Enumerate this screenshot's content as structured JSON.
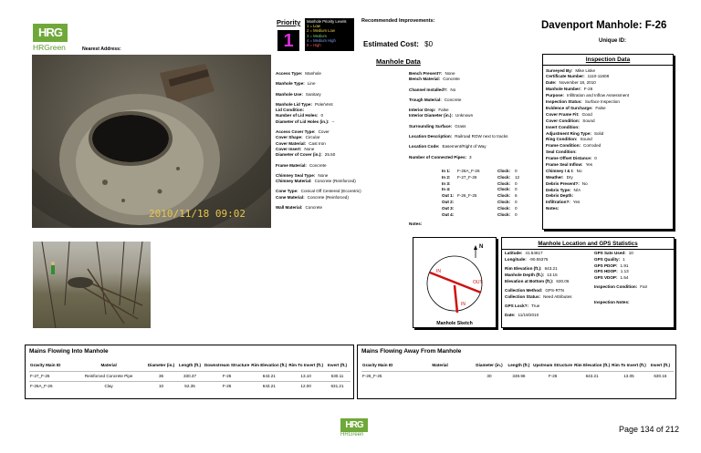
{
  "brand": {
    "logo_text": "HRGreen",
    "logo_mark": "HRG"
  },
  "header": {
    "nearest_address_label": "Nearest Address:",
    "priority_label": "Priority",
    "priority_value": "1",
    "priority_legend_title": "Manhole Priority Levels",
    "priority_legend": [
      "1 = Low",
      "2 = Medium Low",
      "3 = Medium",
      "4 = Medium High",
      "5 = High"
    ],
    "recommended_label": "Recommended Improvements:",
    "estimated_cost_label": "Estimated Cost:",
    "estimated_cost_value": "$0",
    "title": "Davenport Manhole:  F-26",
    "unique_id_label": "Unique ID:"
  },
  "photo1": {
    "timestamp": "2010/11/18  09:02"
  },
  "manhole_data": {
    "title": "Manhole Data",
    "left_col": [
      {
        "label": "Access Type:",
        "value": "Manhole"
      },
      {
        "label": "Manhole Type:",
        "value": "Line"
      },
      {
        "label": "Manhole Use:",
        "value": "Sanitary"
      },
      {
        "label": "Manhole Lid Type:",
        "value": "Pole/Vent"
      },
      {
        "label": "Lid Condition:",
        "value": ""
      },
      {
        "label": "Number of Lid Holes:",
        "value": "0"
      },
      {
        "label": "Diameter of Lid Holes (in.):",
        "value": "--"
      },
      {
        "label": "Access Cover Type:",
        "value": "Cover"
      },
      {
        "label": "Cover Shape:",
        "value": "Circular"
      },
      {
        "label": "Cover Material:",
        "value": "Cast Iron"
      },
      {
        "label": "Cover Insert:",
        "value": "None"
      },
      {
        "label": "Diameter of Cover (in.):",
        "value": "25.50"
      },
      {
        "label": "Frame Material:",
        "value": "Concrete"
      },
      {
        "label": "Chimney Seal Type:",
        "value": "None"
      },
      {
        "label": "Chimney Material:",
        "value": "Concrete (Reinforced)"
      },
      {
        "label": "Cone Type:",
        "value": "Conical Off Centered (Eccentric)"
      },
      {
        "label": "Cone Material:",
        "value": "Concrete (Reinforced)"
      },
      {
        "label": "Wall Material:",
        "value": "Concrete"
      }
    ],
    "right_col": [
      {
        "label": "Bench Present?:",
        "value": "None"
      },
      {
        "label": "Bench Material:",
        "value": "Concrete"
      },
      {
        "label": "Channel Installed?:",
        "value": "No"
      },
      {
        "label": "Trough Material:",
        "value": "Concrete"
      },
      {
        "label": "Interior Drop:",
        "value": "False"
      },
      {
        "label": "Interior Diameter (in.):",
        "value": "Unknown"
      },
      {
        "label": "Surrounding Surface:",
        "value": "Grass"
      },
      {
        "label": "Location Description:",
        "value": "Railroad ROW next to tracks"
      },
      {
        "label": "Location Code:",
        "value": "Easement/Right of Way"
      },
      {
        "label": "Number of Connected Pipes:",
        "value": "3"
      }
    ],
    "pipes": [
      {
        "label": "In 1:",
        "value": "F-26A_F-26",
        "clock_label": "Clock:",
        "clock": "0"
      },
      {
        "label": "In 2:",
        "value": "F-27_F-26",
        "clock_label": "Clock:",
        "clock": "12"
      },
      {
        "label": "In 3:",
        "value": "",
        "clock_label": "Clock:",
        "clock": "0"
      },
      {
        "label": "In 4:",
        "value": "",
        "clock_label": "Clock:",
        "clock": "0"
      },
      {
        "label": "Out 1:",
        "value": "F-26_F-25",
        "clock_label": "Clock:",
        "clock": "6"
      },
      {
        "label": "Out 2:",
        "value": "",
        "clock_label": "Clock:",
        "clock": "0"
      },
      {
        "label": "Out 3:",
        "value": "",
        "clock_label": "Clock:",
        "clock": "0"
      },
      {
        "label": "Out 4:",
        "value": "",
        "clock_label": "Clock:",
        "clock": "0"
      }
    ],
    "notes_label": "Notes:"
  },
  "inspection": {
    "title": "Inspection Data",
    "rows": [
      {
        "label": "Surveyed By:",
        "value": "Mike Liske"
      },
      {
        "label": "Certificate Number:",
        "value": "1110-11608"
      },
      {
        "label": "Date:",
        "value": "November 18, 2010"
      },
      {
        "label": "Manhole Number:",
        "value": "F-26"
      },
      {
        "label": "Purpose:",
        "value": "Infiltration and Inflow Assessment"
      },
      {
        "label": "Inspection Status:",
        "value": "Surface Inspection"
      },
      {
        "label": "Evidence of Surcharge:",
        "value": "False"
      },
      {
        "label": "Cover Frame Fit:",
        "value": "Good"
      },
      {
        "label": "Cover Condition:",
        "value": "Sound"
      },
      {
        "label": "Insert Condition:",
        "value": ""
      },
      {
        "label": "Adjustment Ring Type:",
        "value": "Solid"
      },
      {
        "label": "Ring Condition:",
        "value": "Sound"
      },
      {
        "label": "Frame Condition:",
        "value": "Corroded"
      },
      {
        "label": "Seal Condition:",
        "value": ""
      },
      {
        "label": "Frame Offset Distance:",
        "value": "0"
      },
      {
        "label": "Frame Seal Inflow:",
        "value": "Yes"
      },
      {
        "label": "Chimney I & I:",
        "value": "No"
      },
      {
        "label": "Weather:",
        "value": "Dry"
      },
      {
        "label": "Debris Present?:",
        "value": "No"
      },
      {
        "label": "Debris Type:",
        "value": "N/A"
      },
      {
        "label": "Debris Depth:",
        "value": ""
      },
      {
        "label": "Infiltration?:",
        "value": "Yes"
      },
      {
        "label": "Notes:",
        "value": ""
      }
    ]
  },
  "location": {
    "title": "Manhole Location and GPS Statistics",
    "left": [
      {
        "label": "Latitude:",
        "value": "41.54617"
      },
      {
        "label": "Longitude:",
        "value": "-90.55375"
      },
      {
        "label": "Rim Elevation (ft.):",
        "value": "643.21"
      },
      {
        "label": "Manhole Depth (ft.):",
        "value": "13.15"
      },
      {
        "label": "Elevation at Bottom (ft.):",
        "value": "630.06"
      },
      {
        "label": "Collection Method:",
        "value": "GPS-RTN"
      },
      {
        "label": "Collection Status:",
        "value": "Need Attributes"
      },
      {
        "label": "GPS Lock?:",
        "value": "True"
      },
      {
        "label": "Date:",
        "value": "11/19/2010"
      }
    ],
    "right": [
      {
        "label": "GPS Sats Used:",
        "value": "10"
      },
      {
        "label": "GPS Quality:",
        "value": "1"
      },
      {
        "label": "GPS PDOP:",
        "value": "1.91"
      },
      {
        "label": "GPS HDOP:",
        "value": "1.13"
      },
      {
        "label": "GPS VDOP:",
        "value": "1.54"
      },
      {
        "label": "Inspection Condition:",
        "value": "Fair"
      },
      {
        "label": "Inspection Notes:",
        "value": ""
      }
    ]
  },
  "sketch": {
    "title": "Manhole Sketch",
    "in_label": "IN",
    "out_label": "OUT",
    "north": "N"
  },
  "into_table": {
    "title": "Mains Flowing Into Manhole",
    "headers": [
      "Gravity Main ID",
      "Material",
      "Diameter (in.)",
      "Length (ft.)",
      "Downstream Structure",
      "Rim Elevation (ft.)",
      "Rim To Invert (ft.)",
      "Invert (ft.)"
    ],
    "rows": [
      [
        "F-27_F-26",
        "Reinforced Concrete Pipe",
        "36",
        "330.37",
        "F-26",
        "643.21",
        "13.10",
        "630.11"
      ],
      [
        "F-26A_F-26",
        "Clay",
        "10",
        "52.35",
        "F-26",
        "643.21",
        "12.00",
        "631.21"
      ]
    ]
  },
  "away_table": {
    "title": "Mains Flowing Away From Manhole",
    "headers": [
      "Gravity Main ID",
      "Material",
      "Diameter (in.)",
      "Length (ft.)",
      "Upstream Structure",
      "Rim Elevation (ft.)",
      "Rim To Invert (ft.)",
      "Invert (ft.)"
    ],
    "rows": [
      [
        "F-26_F-25",
        "",
        "30",
        "349.96",
        "F-26",
        "643.21",
        "13.05",
        "630.16"
      ]
    ]
  },
  "footer": {
    "page": "Page 134 of 212"
  }
}
